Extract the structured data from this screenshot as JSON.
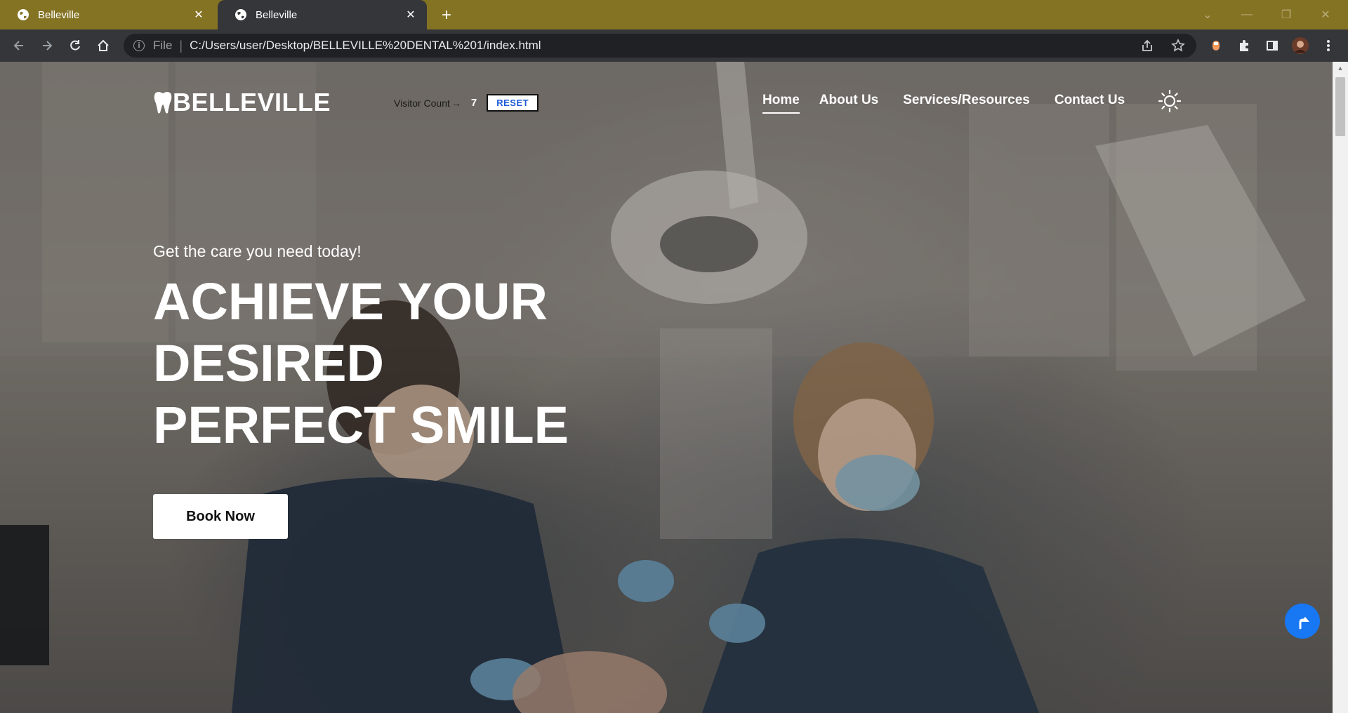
{
  "browser": {
    "tabs": [
      {
        "title": "Belleville",
        "active": false
      },
      {
        "title": "Belleville",
        "active": true
      }
    ],
    "address": {
      "scheme_label": "File",
      "url": "C:/Users/user/Desktop/BELLEVILLE%20DENTAL%201/index.html"
    }
  },
  "site": {
    "logo_text": "BELLEVILLE",
    "visitor": {
      "label": "Visitor Count",
      "arrow": "→",
      "count": "7",
      "reset_label": "RESET"
    },
    "nav": [
      {
        "label": "Home",
        "active": true
      },
      {
        "label": "About Us",
        "active": false
      },
      {
        "label": "Services/Resources",
        "active": false
      },
      {
        "label": "Contact Us",
        "active": false
      }
    ],
    "theme_icon": "sun-icon"
  },
  "hero": {
    "subtitle": "Get the care you need today!",
    "title_lines": [
      "ACHIEVE YOUR",
      "DESIRED",
      "PERFECT SMILE"
    ],
    "cta_label": "Book Now"
  },
  "colors": {
    "tabbar": "#857324",
    "chrome": "#35363a",
    "accent_blue": "#1877f2",
    "reset_text": "#1e5bd8"
  }
}
